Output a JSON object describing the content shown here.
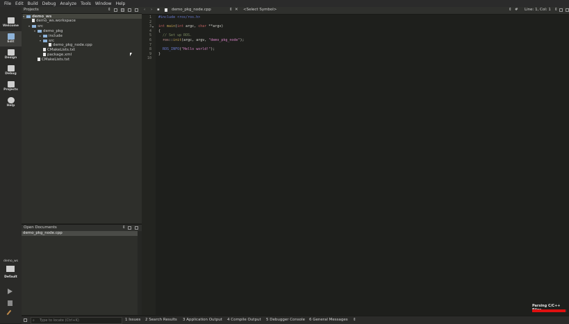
{
  "menu": [
    "File",
    "Edit",
    "Build",
    "Debug",
    "Analyze",
    "Tools",
    "Window",
    "Help"
  ],
  "modes": [
    {
      "label": "Welcome",
      "icon": "grid-icon"
    },
    {
      "label": "Edit",
      "icon": "edit-icon"
    },
    {
      "label": "Design",
      "icon": "pencil-icon"
    },
    {
      "label": "Debug",
      "icon": "bug-icon"
    },
    {
      "label": "Projects",
      "icon": "wrench-icon"
    },
    {
      "label": "Help",
      "icon": "help-icon"
    }
  ],
  "projects": {
    "title": "Projects",
    "tree": [
      {
        "name": "demo_ws",
        "level": 0,
        "type": "project",
        "expanded": true
      },
      {
        "name": "demo_ws.workspace",
        "level": 1,
        "type": "file"
      },
      {
        "name": "src",
        "level": 1,
        "type": "folder",
        "expanded": true
      },
      {
        "name": "demo_pkg",
        "level": 2,
        "type": "folder",
        "expanded": true
      },
      {
        "name": "include",
        "level": 3,
        "type": "folder",
        "expanded": false
      },
      {
        "name": "src",
        "level": 3,
        "type": "folder",
        "expanded": true
      },
      {
        "name": "demo_pkg_node.cpp",
        "level": 4,
        "type": "file"
      },
      {
        "name": "CMakeLists.txt",
        "level": 3,
        "type": "file"
      },
      {
        "name": "package.xml",
        "level": 3,
        "type": "file"
      },
      {
        "name": "CMakeLists.txt",
        "level": 2,
        "type": "file"
      }
    ]
  },
  "open_documents": {
    "title": "Open Documents",
    "items": [
      "demo_pkg_node.cpp"
    ]
  },
  "editor": {
    "file": "demo_pkg_node.cpp",
    "symbol": "<Select Symbol>",
    "hash": "#",
    "position": "Line: 1, Col: 1",
    "lines": [
      [
        {
          "t": "#include <ros/ros.h>",
          "c": "#6a7bd0"
        }
      ],
      [],
      [
        {
          "t": "int ",
          "c": "#c06060"
        },
        {
          "t": "main",
          "c": "#c0a050"
        },
        {
          "t": "(",
          "c": "#d8d8d2"
        },
        {
          "t": "int ",
          "c": "#c06060"
        },
        {
          "t": "argc, ",
          "c": "#d8d8d2"
        },
        {
          "t": "char ",
          "c": "#c06060"
        },
        {
          "t": "**argv)",
          "c": "#d8d8d2"
        }
      ],
      [
        {
          "t": "{",
          "c": "#d8d8d2"
        }
      ],
      [
        {
          "t": "  // Set up ROS.",
          "c": "#7a8a60"
        }
      ],
      [
        {
          "t": "  ros",
          "c": "#d8a0a0"
        },
        {
          "t": "::",
          "c": "#d8d8d2"
        },
        {
          "t": "init",
          "c": "#c0a050"
        },
        {
          "t": "(argc, argv, ",
          "c": "#d8d8d2"
        },
        {
          "t": "\"demo_pkg_node\"",
          "c": "#d080c0"
        },
        {
          "t": ");",
          "c": "#d8d8d2"
        }
      ],
      [],
      [
        {
          "t": "  ROS_INFO",
          "c": "#6a7bd0"
        },
        {
          "t": "(",
          "c": "#d8d8d2"
        },
        {
          "t": "\"Hello world!\"",
          "c": "#d080c0"
        },
        {
          "t": ");",
          "c": "#d8d8d2"
        }
      ],
      [
        {
          "t": "}",
          "c": "#d8d8d2"
        }
      ],
      []
    ]
  },
  "kit": {
    "project": "demo_ws",
    "config": "Default"
  },
  "locator": {
    "placeholder": "Type to locate (Ctrl+K)"
  },
  "output_tabs": [
    "1  Issues",
    "2  Search Results",
    "3  Application Output",
    "4  Compile Output",
    "5  Debugger Console",
    "6  General Messages"
  ],
  "status": {
    "parsing": "Parsing C/C++ Files",
    "progress": 0.95
  }
}
